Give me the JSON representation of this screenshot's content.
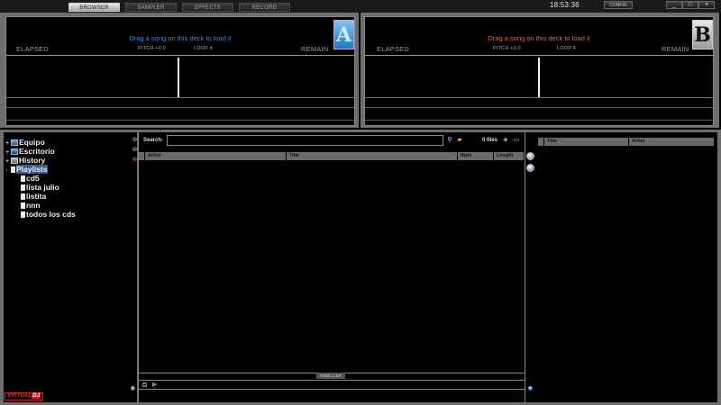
{
  "tabs": [
    {
      "label": "BROWSER",
      "active": true
    },
    {
      "label": "SAMPLER",
      "active": false
    },
    {
      "label": "EFFECTS",
      "active": false
    },
    {
      "label": "RECORD",
      "active": false
    }
  ],
  "clock": "18:53:36",
  "config_label": "CONFIG",
  "window_buttons": {
    "minimize": "_",
    "maximize": "□",
    "close": "×"
  },
  "deck_a": {
    "message": "Drag a song on this deck to load it",
    "elapsed": "ELAPSED",
    "remain": "REMAIN",
    "pitch": "PITCH +0.0",
    "loop": "LOOP 4",
    "letter": "A",
    "message_color": "#2f8fe8"
  },
  "deck_b": {
    "message": "Drag a song on this deck to load it",
    "elapsed": "ELAPSED",
    "remain": "REMAIN",
    "pitch": "PITCH +0.0",
    "loop": "LOOP 4",
    "letter": "B",
    "message_color": "#e86a2a"
  },
  "tree": {
    "items": [
      {
        "label": "Equipo",
        "expander": "+"
      },
      {
        "label": "Escritorio",
        "expander": "+"
      },
      {
        "label": "History",
        "expander": "+"
      },
      {
        "label": "Playlists",
        "expander": "-"
      },
      {
        "label": "cd5"
      },
      {
        "label": "lista julio"
      },
      {
        "label": "listita"
      },
      {
        "label": "nnn"
      },
      {
        "label": "todos los cds"
      }
    ]
  },
  "search": {
    "label": "Search:",
    "value": "",
    "files": "0 files"
  },
  "columns": {
    "artist": "Artist",
    "title": "Title",
    "bpm": "Bpm",
    "length": "Length"
  },
  "side_list": {
    "label": "SIDE LIST",
    "title": "Title",
    "artist": "Artist"
  },
  "logo": {
    "left": "VIRTUAL",
    "right": "DJ"
  }
}
